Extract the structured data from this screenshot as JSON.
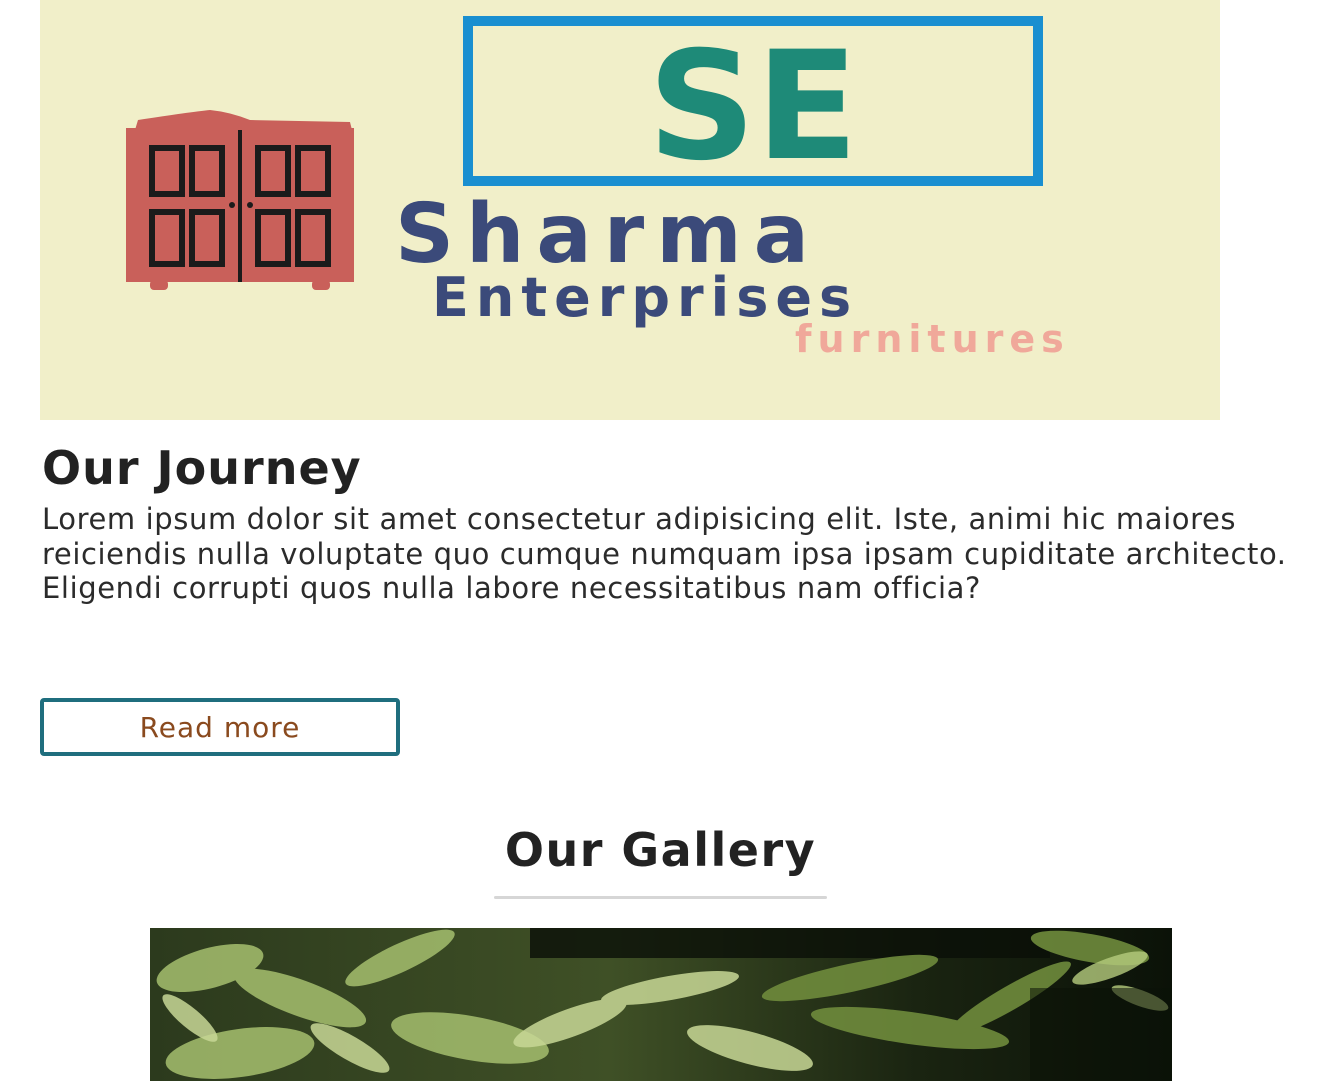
{
  "logo": {
    "monogram": "SE",
    "line1": "Sharma",
    "line2": "Enterprises",
    "line3": "furnitures",
    "colors": {
      "background": "#f1efc9",
      "box": "#1a8fd0",
      "monogram": "#1e8a78",
      "name": "#3b4a7a",
      "tagline": "#f0a89a",
      "wardrobe": "#c9605a"
    }
  },
  "journey": {
    "title": "Our Journey",
    "body": "Lorem ipsum dolor sit amet consectetur adipisicing elit. Iste, animi hic maiores reiciendis nulla voluptate quo cumque numquam ipsa ipsam cupiditate architecto. Eligendi corrupti quos nulla labore necessitatibus nam officia?",
    "button_label": "Read more"
  },
  "gallery": {
    "title": "Our Gallery"
  },
  "colors": {
    "button_border": "#1f6e7e",
    "button_text": "#8a4a1e",
    "divider": "#d6d6d6"
  }
}
